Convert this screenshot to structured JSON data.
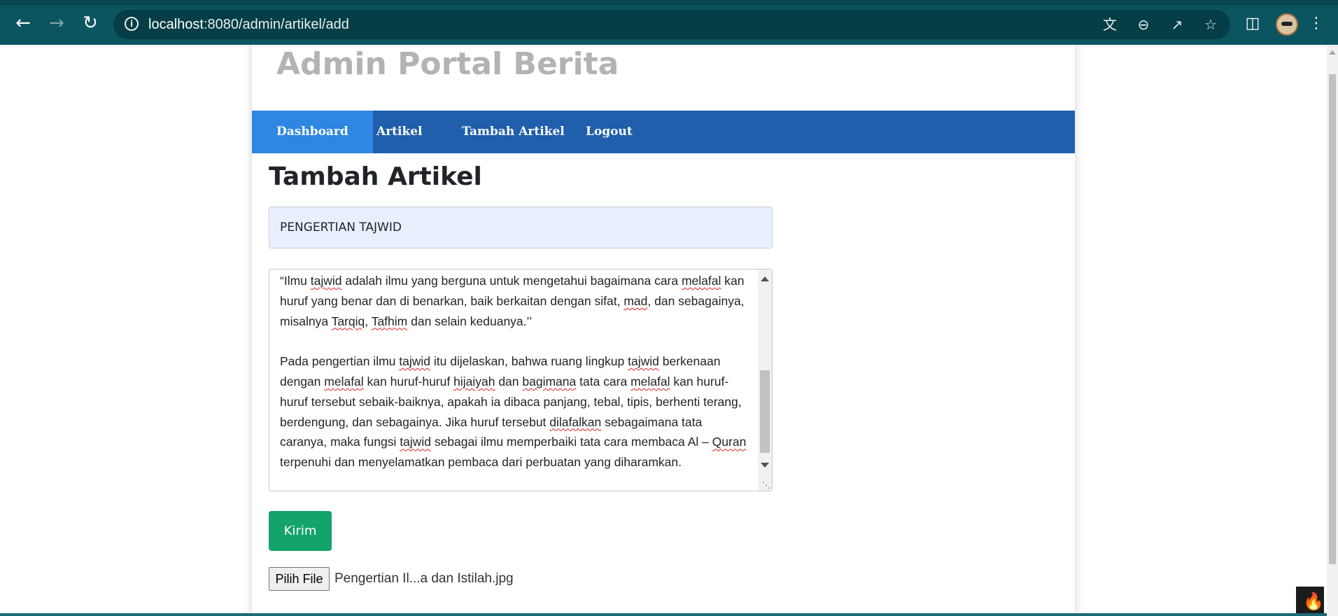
{
  "browser": {
    "url_host": "localhost",
    "url_path": ":8080/admin/artikel/add",
    "icons": {
      "back": "back-arrow-icon",
      "forward": "forward-arrow-icon",
      "reload": "reload-icon",
      "info": "site-info-icon",
      "translate": "translate-icon",
      "zoom": "zoom-out-icon",
      "share": "share-icon",
      "bookmark": "star-icon",
      "sidepanel": "side-panel-icon",
      "profile": "profile-avatar",
      "menu": "kebab-menu-icon"
    }
  },
  "site": {
    "title": "Admin Portal Berita"
  },
  "nav": {
    "items": [
      {
        "label": "Dashboard",
        "active": true
      },
      {
        "label": "Artikel"
      },
      {
        "label": "Tambah Artikel"
      },
      {
        "label": "Logout"
      }
    ]
  },
  "form": {
    "heading": "Tambah Artikel",
    "title_value": "PENGERTIAN TAJWID",
    "content": {
      "p1": [
        "“Ilmu ",
        "tajwid",
        " adalah ilmu yang berguna untuk mengetahui bagaimana cara ",
        "melafal",
        " kan huruf yang benar dan di benarkan, baik berkaitan dengan sifat, ",
        "mad",
        ", dan sebagainya, misalnya ",
        "Tarqiq",
        ", ",
        "Tafhim",
        " dan selain keduanya.’’"
      ],
      "p2": [
        "Pada pengertian ilmu ",
        "tajwid",
        " itu dijelaskan, bahwa ruang lingkup ",
        "tajwid",
        " berkenaan dengan ",
        "melafal",
        " kan huruf-huruf ",
        "hijaiyah",
        " dan ",
        "bagimana",
        " tata cara ",
        "melafal",
        " kan huruf-huruf tersebut sebaik-baiknya, apakah ia dibaca panjang, tebal, tipis, berhenti terang, berdengung, dan sebagainya. Jika huruf tersebut ",
        "dilafalkan",
        " sebagaimana tata caranya, maka fungsi ",
        "tajwid",
        " sebagai ilmu memperbaiki tata cara membaca Al – ",
        "Quran",
        " terpenuhi dan menyelamatkan pembaca dari perbuatan yang diharamkan."
      ]
    },
    "submit_label": "Kirim",
    "file_button_label": "Pilih File",
    "file_name": "Pengertian Il...a dan Istilah.jpg"
  },
  "colors": {
    "browser_chrome": "#0b5560",
    "navbar": "#1f5fac",
    "navbar_active": "#2f86e3",
    "submit": "#12a46a",
    "title_input_bg": "#e8f0fd",
    "site_title": "#b3b3b3"
  }
}
